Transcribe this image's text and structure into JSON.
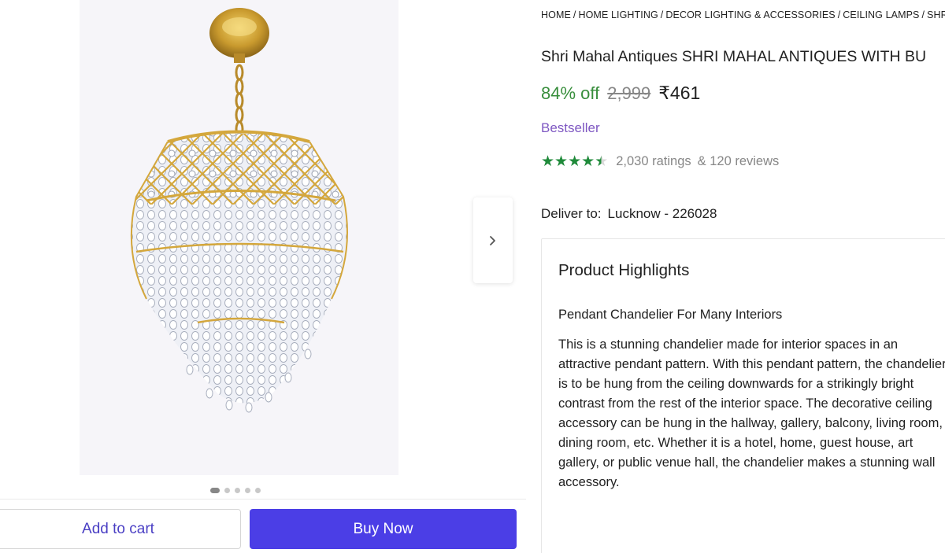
{
  "breadcrumb": {
    "items": [
      "HOME",
      "HOME LIGHTING",
      "DECOR LIGHTING & ACCESSORIES",
      "CEILING LAMPS",
      "SHRI"
    ]
  },
  "product": {
    "title": "Shri Mahal Antiques SHRI MAHAL ANTIQUES WITH BU",
    "discount": "84% off",
    "mrp": "2,999",
    "price": "₹461",
    "badge": "Bestseller",
    "rating_value": 4.5,
    "ratings": "2,030 ratings",
    "reviews": "& 120 reviews",
    "deliver_label": "Deliver to:",
    "deliver_location": "Lucknow - 226028"
  },
  "highlights": {
    "heading": "Product Highlights",
    "subheading": "Pendant Chandelier For Many Interiors",
    "body": "This is a stunning chandelier made for interior spaces in an attractive pendant pattern. With this pendant pattern, the chandelier is to be hung from the ceiling downwards for a strikingly bright contrast from the rest of the interior space. The decorative ceiling accessory can be hung in the hallway, gallery, balcony, living room, dining room, etc. Whether it is a hotel, home, guest house, art gallery, or public venue hall, the chandelier makes a stunning wall accessory."
  },
  "gallery": {
    "image_count": 5,
    "active_index": 0,
    "next_icon": "chevron-right-icon"
  },
  "actions": {
    "add_to_cart": "Add to cart",
    "buy_now": "Buy Now"
  },
  "colors": {
    "discount": "#388e3c",
    "badge": "#7e57c2",
    "buy_button": "#4b3ee6",
    "cart_text": "#4a3fc4",
    "stars": "#1f8a3a"
  }
}
